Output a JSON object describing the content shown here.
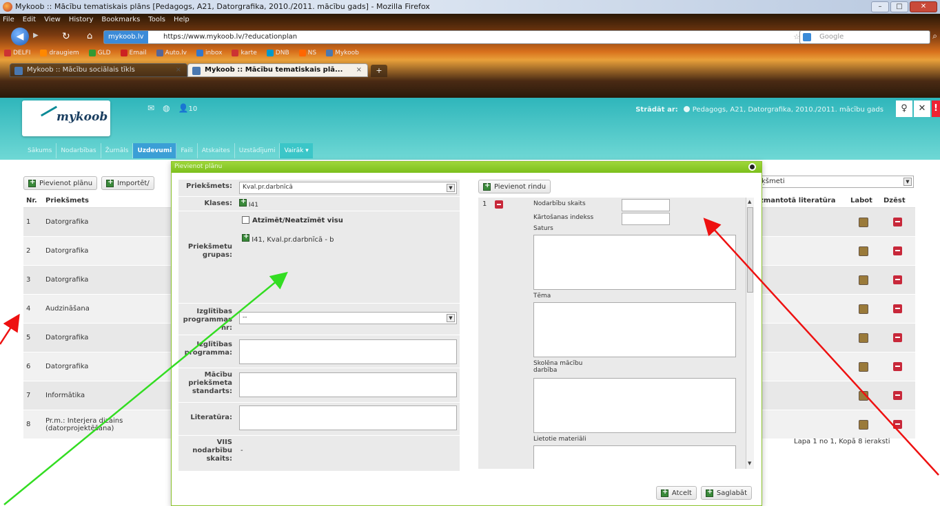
{
  "browser": {
    "title": "Mykoob :: Mācību tematiskais plāns [Pedagogs, A21, Datorgrafika, 2010./2011. mācību gads] - Mozilla Firefox",
    "menu": [
      "File",
      "Edit",
      "View",
      "History",
      "Bookmarks",
      "Tools",
      "Help"
    ],
    "url_badge": "mykoob.lv",
    "url": "https://www.mykoob.lv/?educationplan",
    "search_placeholder": "Google",
    "bookmarks": [
      "DELFI",
      "draugiem",
      "GLD",
      "Email",
      "Auto.lv",
      "inbox",
      "karte",
      "DNB",
      "NS",
      "Mykoob"
    ],
    "tabs": [
      {
        "label": "Mykoob :: Mācību sociālais tīkls"
      },
      {
        "label": "Mykoob :: Mācību tematiskais plā..."
      }
    ],
    "new_tab": "+"
  },
  "app": {
    "logo": "mykoob",
    "header_count": "10",
    "work_as_label": "Strādāt ar:",
    "work_as_value": "Pedagogs, A21, Datorgrafika, 2010./2011. mācību gads",
    "nav": [
      "Sākums",
      "Nodarbības",
      "Žurnāls",
      "Uzdevumi",
      "Faili",
      "Atskaites",
      "Uzstādījumi",
      "Vairāk ▾"
    ],
    "toolbar": {
      "add_plan": "Pievienot plānu",
      "import": "Importēt/"
    },
    "right_select": "ķšmeti",
    "table": {
      "headers": {
        "nr": "Nr.",
        "subject": "Priekšmets",
        "literature": "zmantotā literatūra",
        "edit": "Labot",
        "delete": "Dzēst"
      },
      "rows": [
        {
          "nr": "1",
          "subject": "Datorgrafika"
        },
        {
          "nr": "2",
          "subject": "Datorgrafika"
        },
        {
          "nr": "3",
          "subject": "Datorgrafika"
        },
        {
          "nr": "4",
          "subject": "Audzināšana"
        },
        {
          "nr": "5",
          "subject": "Datorgrafika"
        },
        {
          "nr": "6",
          "subject": "Datorgrafika"
        },
        {
          "nr": "7",
          "subject": "Informātika"
        },
        {
          "nr": "8",
          "subject": "Pr.m.: Interjera dizains (datorprojektēšana)"
        }
      ]
    },
    "paging": "Lapa 1 no 1, Kopā 8 ieraksti"
  },
  "dialog": {
    "title": "Pievienot plānu",
    "subject_label": "Priekšmets:",
    "subject_value": "Kval.pr.darbnīcā",
    "classes_label": "Klases:",
    "classes_value": "I41",
    "toggle_all": "Atzīmēt/Neatzīmēt visu",
    "group_item": "I41,  Kval.pr.darbnīcā -  b",
    "groups_label": "Priekšmetu grupas:",
    "program_nr_label": "Izglītības programmas nr:",
    "program_nr_value": "--",
    "program_label": "Izglītības programma:",
    "standard_label": "Mācību priekšmeta standarts:",
    "literature_label": "Literatūra:",
    "viis_label": "VIIS nodarbību skaits:",
    "viis_value": "-",
    "add_row": "Pievienot rindu",
    "row_number": "1",
    "lesson_count": "Nodarbību skaits",
    "sort_index": "Kārtošanas indekss",
    "content": "Saturs",
    "topic": "Tēma",
    "student_activity": "Skolēna mācību darbība",
    "materials": "Lietotie materiāli",
    "cancel": "Atcelt",
    "save": "Saglabāt"
  },
  "colors": {
    "accent": "#2fb6bb",
    "dialog_header": "#7cbf1c",
    "green_arrow": "#33dd22",
    "red_arrow": "#ee1111"
  }
}
